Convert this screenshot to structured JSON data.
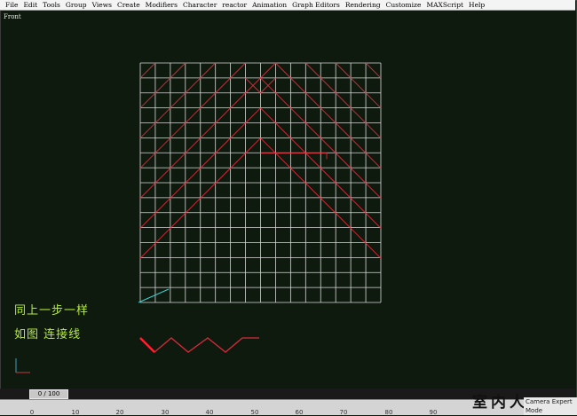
{
  "menu": [
    "File",
    "Edit",
    "Tools",
    "Group",
    "Views",
    "Create",
    "Modifiers",
    "Character",
    "reactor",
    "Animation",
    "Graph Editors",
    "Rendering",
    "Customize",
    "MAXScript",
    "Help"
  ],
  "viewport": {
    "label": "Front"
  },
  "notes": {
    "line1": "同上一步一样",
    "line2": "如图  连接线"
  },
  "timeline": {
    "slider_label": "0 / 100",
    "ticks": [
      "0",
      "10",
      "20",
      "30",
      "40",
      "50",
      "60",
      "70",
      "80",
      "90"
    ]
  },
  "status": {
    "mode": "Camera Expert Mode"
  },
  "watermark": {
    "text": "室内人"
  },
  "colors": {
    "background": "#0f1a0f",
    "grid": "#d8d8d8",
    "spline": "#d82a3a",
    "note": "#b4ec3c"
  }
}
